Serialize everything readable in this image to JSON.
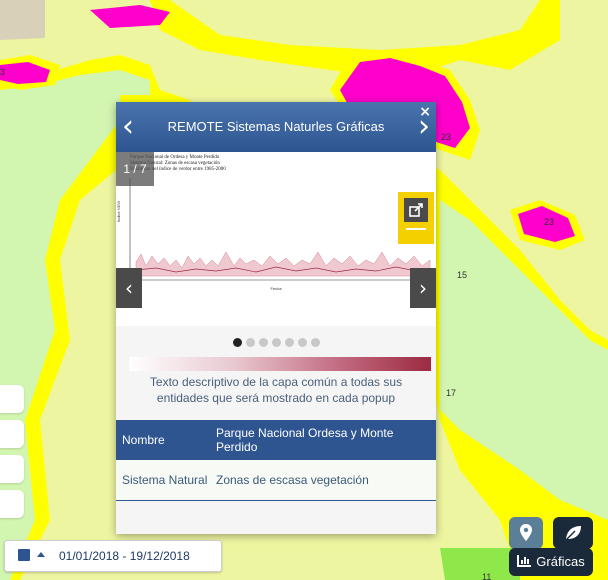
{
  "map": {
    "labels": [
      "3",
      "23",
      "23",
      "15",
      "17",
      "11",
      "3"
    ]
  },
  "popup": {
    "title": "REMOTE Sistemas Naturles Gráficas",
    "prev_icon": "chevron-left-icon",
    "next_icon": "chevron-right-icon",
    "close": "×",
    "counter": "1 / 7",
    "chart_prev": "‹",
    "chart_next": "›",
    "chart_text": {
      "caption_1": "Parque Nacional de Ordesa y Monte Perdido",
      "caption_2": "Sistema Natural: Zonas de escasa vegetación",
      "caption_3": "Evolución del índice de verdor entre 1985-2000",
      "ylabel": "Índice NDVI",
      "xlabel": "Fecha"
    },
    "description": "Texto descriptivo de la capa común a todas sus entidades que será mostrado en cada popup",
    "table": {
      "header": {
        "key": "Nombre",
        "value": "Parque Nacional Ordesa y Monte Perdido"
      },
      "row": {
        "key": "Sistema Natural",
        "value": "Zonas de escasa vegetación"
      }
    }
  },
  "bottom": {
    "date_range": "01/01/2018 - 19/12/2018",
    "graficas_label": "Gráficas"
  },
  "colors": {
    "accent": "#2e5590",
    "map_base": "#eef5a0",
    "map_green": "#d2f5b0",
    "map_magenta": "#ff00cc",
    "map_yellow": "#ffff00",
    "highlight": "#f5d000"
  }
}
